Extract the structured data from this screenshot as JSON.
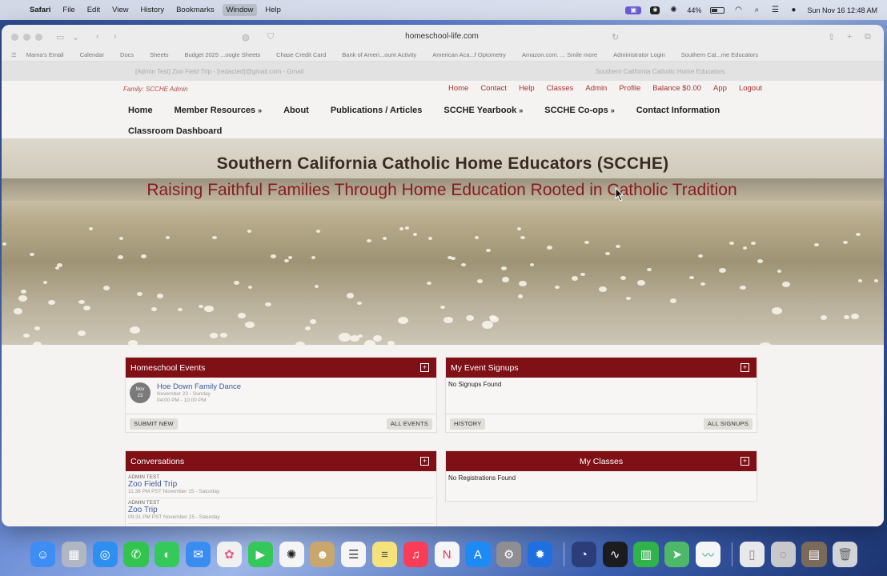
{
  "menubar": {
    "apple": "",
    "items": [
      "Safari",
      "File",
      "Edit",
      "View",
      "History",
      "Bookmarks",
      "Window",
      "Help"
    ],
    "battery": "44%",
    "datetime": "Sun Nov 16  12:48 AM"
  },
  "browser": {
    "url": "homeschool-life.com",
    "bookmarks": [
      "Mama's Email",
      "Calendar",
      "Docs",
      "Sheets",
      "Budget 2025 ...oogle Sheets",
      "Chase Credit Card",
      "Bank of Ameri...ount Activity",
      "American Aca...f Optometry",
      "Amazon.com. ... Smile more",
      "Administrator Login",
      "Southern Cal...me Educators"
    ],
    "tabs": [
      "[Admin Test] Zoo Field Trip - [redacted]@gmail.com - Gmail",
      "Southern California Catholic Home Educators"
    ]
  },
  "site": {
    "family_label": "Family: SCCHE Admin",
    "top_links": [
      "Home",
      "Contact",
      "Help",
      "Classes",
      "Admin",
      "Profile",
      "Balance $0.00",
      "App",
      "Logout"
    ],
    "nav_row1": [
      {
        "label": "Home",
        "arrow": ""
      },
      {
        "label": "Member Resources",
        "arrow": "»"
      },
      {
        "label": "About",
        "arrow": ""
      },
      {
        "label": "Publications / Articles",
        "arrow": ""
      },
      {
        "label": "SCCHE Yearbook",
        "arrow": "»"
      },
      {
        "label": "SCCHE Co-ops",
        "arrow": "»"
      },
      {
        "label": "Contact Information",
        "arrow": ""
      }
    ],
    "nav_row2": "Classroom Dashboard",
    "hero_title": "Southern California Catholic Home Educators (SCCHE)",
    "hero_subtitle": "Raising Faithful Families Through Home Education Rooted in Catholic Tradition"
  },
  "panels": {
    "events": {
      "title": "Homeschool Events",
      "plus": "+",
      "event_month": "Nov",
      "event_day": "23",
      "event_title": "Hoe Down Family Dance",
      "event_date": "November 23 - Sunday",
      "event_time": "04:00 PM - 10:00 PM",
      "btn_left": "SUBMIT NEW",
      "btn_right": "ALL EVENTS"
    },
    "signups": {
      "title": "My Event Signups",
      "plus": "+",
      "empty": "No Signups Found",
      "btn_left": "HISTORY",
      "btn_right": "ALL SIGNUPS"
    },
    "conversations": {
      "title": "Conversations",
      "plus": "+",
      "items": [
        {
          "who": "ADMIN TEST",
          "title": "Zoo Field Trip",
          "when": "11:38 PM PST November 15 - Saturday"
        },
        {
          "who": "ADMIN TEST",
          "title": "Zoo Trip",
          "when": "09:31 PM PST November 15 - Saturday"
        }
      ]
    },
    "classes": {
      "title": "My Classes",
      "plus": "+",
      "empty": "No Registrations Found"
    }
  },
  "dock": {
    "apps": [
      "Finder",
      "Launchpad",
      "Safari",
      "WhatsApp",
      "Messages",
      "Mail",
      "Photos",
      "FaceTime",
      "ChatGPT",
      "Contacts",
      "Reminders",
      "Notes",
      "Music",
      "News",
      "App Store",
      "System Settings",
      "Settings",
      "Disk Utility",
      "Stocks",
      "Numbers",
      "Maps",
      "Freeform",
      "Preview",
      "Photo Booth",
      "Downloads",
      "Trash"
    ]
  },
  "colors": {
    "brand_maroon": "#7f1015",
    "link_blue": "#3b5a9a",
    "top_link_red": "#a83232"
  }
}
